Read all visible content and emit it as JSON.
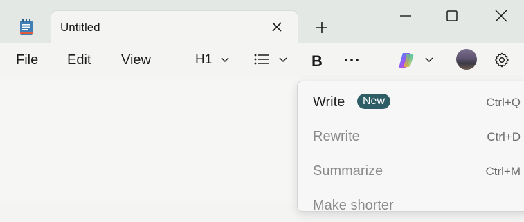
{
  "tab": {
    "title": "Untitled"
  },
  "menu": {
    "file": "File",
    "edit": "Edit",
    "view": "View"
  },
  "toolbar": {
    "heading": "H1"
  },
  "popup": {
    "items": [
      {
        "label": "Write",
        "badge": "New",
        "shortcut": "Ctrl+Q",
        "enabled": true
      },
      {
        "label": "Rewrite",
        "shortcut": "Ctrl+D",
        "enabled": false
      },
      {
        "label": "Summarize",
        "shortcut": "Ctrl+M",
        "enabled": false
      },
      {
        "label": "Make shorter",
        "shortcut": "",
        "enabled": false
      }
    ]
  },
  "colors": {
    "badge": "#2f5d66",
    "accent": "#e4e8e5"
  }
}
